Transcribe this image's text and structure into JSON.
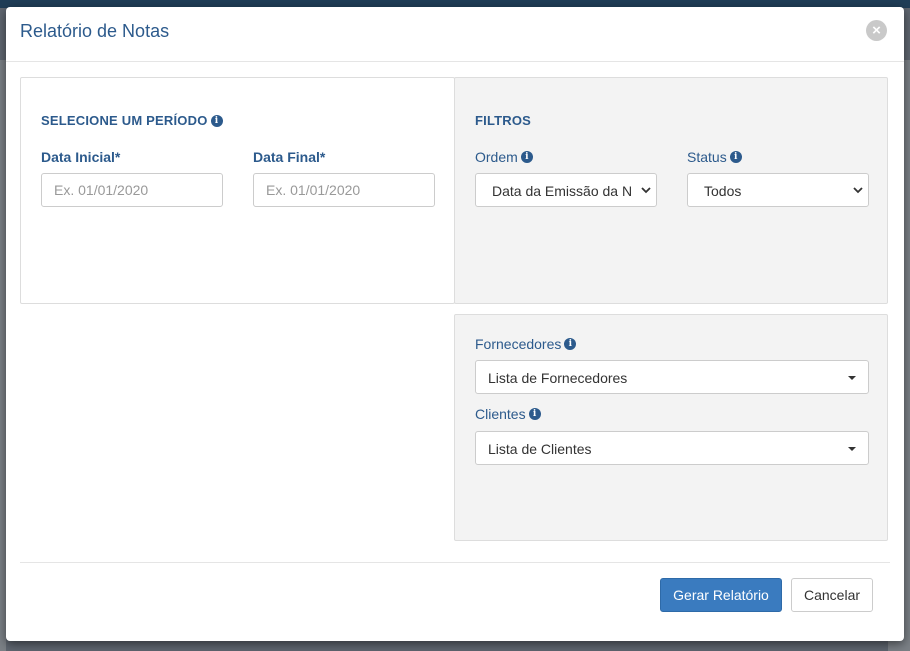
{
  "modal": {
    "title": "Relatório de Notas",
    "close_symbol": "×"
  },
  "periodo": {
    "title": "SELECIONE UM PERÍODO",
    "data_inicial": {
      "label": "Data Inicial*",
      "placeholder": "Ex. 01/01/2020",
      "value": ""
    },
    "data_final": {
      "label": "Data Final*",
      "placeholder": "Ex. 01/01/2020",
      "value": ""
    }
  },
  "filtros": {
    "title": "FILTROS",
    "ordem": {
      "label": "Ordem",
      "value": "Data da Emissão da N"
    },
    "status": {
      "label": "Status",
      "value": "Todos"
    }
  },
  "fornecedores": {
    "label": "Fornecedores",
    "value": "Lista de Fornecedores"
  },
  "clientes": {
    "label": "Clientes",
    "value": "Lista de Clientes"
  },
  "footer": {
    "generate_label": "Gerar Relatório",
    "cancel_label": "Cancelar"
  },
  "icons": {
    "info": "i"
  },
  "colors": {
    "primary": "#3a7bbf",
    "label": "#2c5a8c",
    "panel_bg": "#f3f3f3"
  }
}
